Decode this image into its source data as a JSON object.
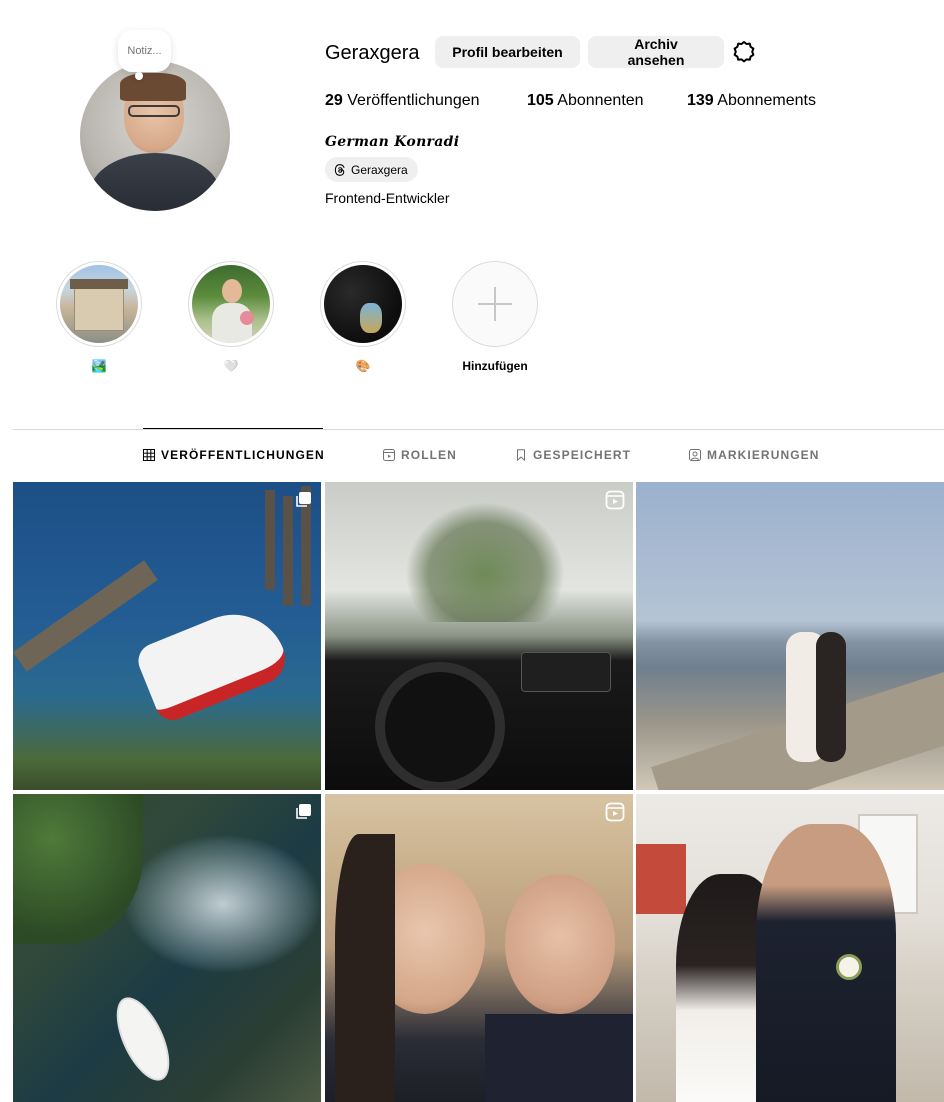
{
  "profile": {
    "note_text": "Notiz...",
    "username": "Geraxgera",
    "edit_button": "Profil bearbeiten",
    "archive_button": "Archiv ansehen",
    "stats": {
      "posts_count": "29",
      "posts_label": "Veröffentlichungen",
      "followers_count": "105",
      "followers_label": "Abonnenten",
      "following_count": "139",
      "following_label": "Abonnements"
    },
    "full_name": "German Konradi",
    "threads_handle": "Geraxgera",
    "bio": "Frontend-Entwickler"
  },
  "highlights": [
    {
      "label": "🏞️"
    },
    {
      "label": "🤍"
    },
    {
      "label": "🎨"
    },
    {
      "label": "Hinzufügen"
    }
  ],
  "tabs": [
    {
      "label": "VERÖFFENTLICHUNGEN",
      "icon": "grid-icon",
      "active": true
    },
    {
      "label": "ROLLEN",
      "icon": "reels-icon",
      "active": false
    },
    {
      "label": "GESPEICHERT",
      "icon": "bookmark-icon",
      "active": false
    },
    {
      "label": "MARKIERUNGEN",
      "icon": "tag-icon",
      "active": false
    }
  ],
  "posts": [
    {
      "subject": "boat-at-pier",
      "badge": "multi-photo-icon"
    },
    {
      "subject": "car-interior-road",
      "badge": "reel-icon"
    },
    {
      "subject": "couple-at-beach",
      "badge": ""
    },
    {
      "subject": "surfboard-river",
      "badge": "multi-photo-icon"
    },
    {
      "subject": "wedding-selfie",
      "badge": "reel-icon"
    },
    {
      "subject": "wedding-kiss",
      "badge": ""
    }
  ],
  "colors": {
    "button_bg": "#efefef",
    "secondary_text": "#737373",
    "divider": "#dbdbdb"
  }
}
